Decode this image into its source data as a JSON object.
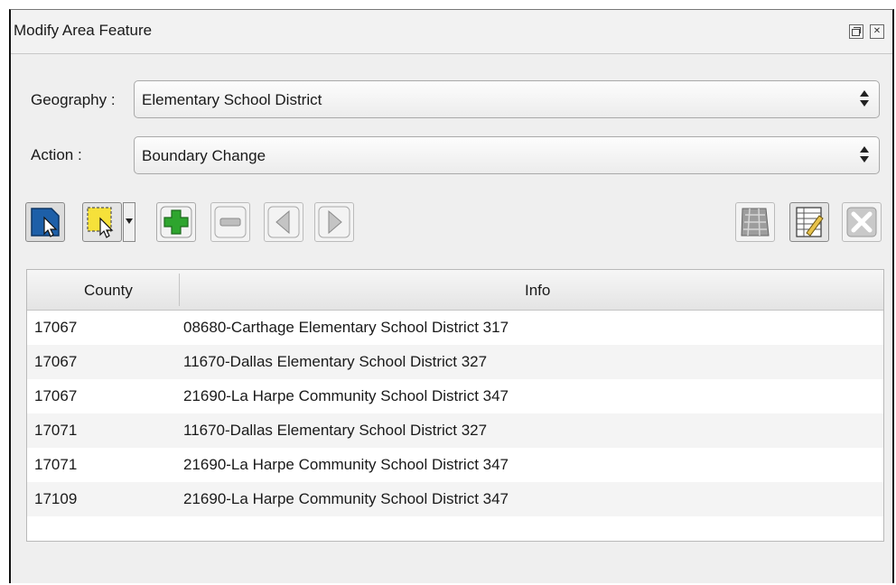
{
  "window": {
    "title": "Modify Area Feature",
    "float_icon": "float-window-icon",
    "close_icon": "close-window-icon"
  },
  "form": {
    "geography_label": "Geography :",
    "geography_value": "Elementary School District",
    "action_label": "Action :",
    "action_value": "Boundary Change"
  },
  "toolbar": {
    "icons": [
      "select-feature-icon",
      "rectangle-select-icon",
      "dropdown-arrow-icon",
      "add-icon",
      "remove-icon",
      "previous-icon",
      "next-icon",
      "map-grid-icon",
      "edit-table-icon",
      "close-x-icon"
    ],
    "accent_colors": {
      "select": "#1d5fa8",
      "rectangle": "#f6e13a",
      "add": "#2ea52e"
    }
  },
  "table": {
    "headers": {
      "county": "County",
      "info": "Info"
    },
    "rows": [
      {
        "county": "17067",
        "info": "08680-Carthage Elementary School District 317"
      },
      {
        "county": "17067",
        "info": "11670-Dallas Elementary School District 327"
      },
      {
        "county": "17067",
        "info": "21690-La Harpe Community School District 347"
      },
      {
        "county": "17071",
        "info": "11670-Dallas Elementary School District 327"
      },
      {
        "county": "17071",
        "info": "21690-La Harpe Community School District 347"
      },
      {
        "county": "17109",
        "info": "21690-La Harpe Community School District 347"
      }
    ]
  }
}
